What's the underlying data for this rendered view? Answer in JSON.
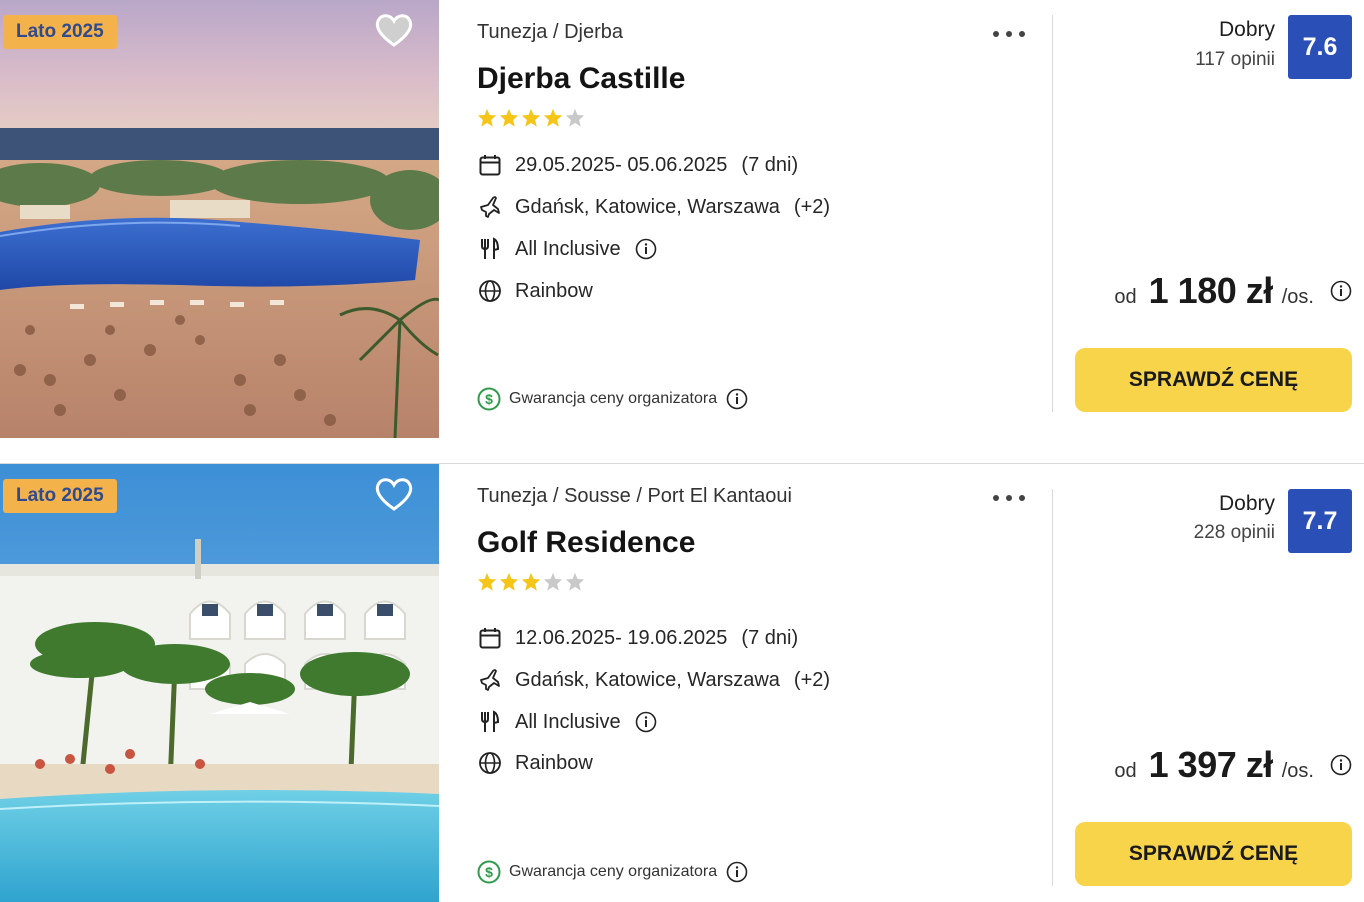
{
  "offers": [
    {
      "season_badge": "Lato 2025",
      "location": "Tunezja / Djerba",
      "name": "Djerba Castille",
      "stars": 4,
      "dates": "29.05.2025- 05.06.2025",
      "duration": "(7 dni)",
      "departures": "Gdańsk, Katowice, Warszawa",
      "departures_extra": "(+2)",
      "board": "All Inclusive",
      "operator": "Rainbow",
      "guarantee": "Gwarancja ceny organizatora",
      "rating_label": "Dobry",
      "rating_count": "117 opinii",
      "score": "7.6",
      "price_prefix": "od",
      "price": "1 180 zł",
      "price_suffix": "/os.",
      "cta": "SPRAWDŹ CENĘ",
      "favorited": true
    },
    {
      "season_badge": "Lato 2025",
      "location": "Tunezja / Sousse / Port El Kantaoui",
      "name": "Golf Residence",
      "stars": 3,
      "dates": "12.06.2025- 19.06.2025",
      "duration": "(7 dni)",
      "departures": "Gdańsk, Katowice, Warszawa",
      "departures_extra": "(+2)",
      "board": "All Inclusive",
      "operator": "Rainbow",
      "guarantee": "Gwarancja ceny organizatora",
      "rating_label": "Dobry",
      "rating_count": "228 opinii",
      "score": "7.7",
      "price_prefix": "od",
      "price": "1 397 zł",
      "price_suffix": "/os.",
      "cta": "SPRAWDŹ CENĘ",
      "favorited": false
    }
  ],
  "colors": {
    "badge_bg": "#f4b24a",
    "badge_text": "#2f4a8e",
    "score_bg": "#2a4fb6",
    "cta_bg": "#f7d44a",
    "star_on": "#f5c518",
    "star_off": "#c9c9c9",
    "guarantee_green": "#2e9b4a"
  },
  "icons": {
    "favorite": "heart-icon",
    "more": "more-dots-icon",
    "dates": "calendar-icon",
    "departures": "plane-icon",
    "board": "cutlery-icon",
    "operator": "globe-icon",
    "guarantee": "dollar-circle-icon",
    "info": "info-icon",
    "star": "star-icon"
  }
}
